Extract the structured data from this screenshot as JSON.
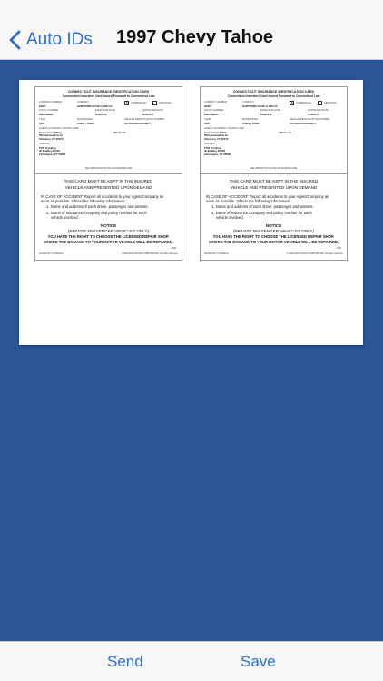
{
  "nav": {
    "back_label": "Auto IDs",
    "title": "1997 Chevy Tahoe"
  },
  "card": {
    "header1": "CONNECTICUT INSURANCE IDENTIFICATION CARD",
    "header2": "Connecticut Insurance Card Issued Pursuant to Connecticut Law",
    "company_number_label": "COMPANY NUMBER",
    "company_number": "22357",
    "company_label": "COMPANY",
    "company": "HARTFORD ACCID & IND CO",
    "commercial_label": "COMMERCIAL",
    "personal_label": "PERSONAL",
    "commercial_checked": "X",
    "policy_number_label": "POLICY NUMBER",
    "policy_number": "WBAHMWA",
    "effective_date_label": "EFFECTIVE DATE",
    "effective_date": "5/20/2016",
    "expiration_date_label": "EXPIRATION DATE",
    "expiration_date": "5/20/2017",
    "year_label": "YEAR",
    "year": "1997",
    "make_model_label": "MAKE/MODEL",
    "make_model": "Chevy / Tahoe",
    "vin_label": "VEHICLE IDENTIFICATION NUMBER",
    "vin": "1GYEK63N76R168971",
    "agency_label": "AGENCY/COMPANY ISSUING CARD",
    "agency_lines": [
      "Connecticut Office",
      "559 Hopmeadow St",
      "Simsbury, CT 06070"
    ],
    "vehicle_location": "Vehicle Co",
    "insured_label": "INSURED",
    "insured_lines": [
      "FTW Trucking",
      "40 Bradley Rd Rd",
      "Farmington, CT 06085"
    ],
    "see_notice": "SEE IMPORTANT NOTICE ON REVERSE SIDE",
    "keep_line1": "THIS CARD MUST BE KEPT IN THE INSURED",
    "keep_line2": "VEHICLE AND PRESENTED UPON DEMAND",
    "accident_line1": "IN CASE OF ACCIDENT:  Report all accidents to your Agent/Company as",
    "accident_line2": "soon as possible.  Obtain the following information:",
    "item1": "1.  Name and address of each driver, passenger and witness.",
    "item2a": "2.  Name of Insurance Company and policy number for each",
    "item2b": "vehicle involved.",
    "notice_title": "NOTICE",
    "notice_sub": "(PRIVATE PASSENGER VEHICLES ONLY)",
    "repair1": "YOU HAVE THE RIGHT TO CHOOSE THE LICENSED REPAIR SHOP.",
    "repair2": "WHERE THE DAMAGE TO YOUR MOTOR VEHICLE WILL BE REPAIRED.",
    "year_code": "2006",
    "form_code": "ACORD 50 CT (2006/01)",
    "copyright": "© 2000-2006 ACORD CORPORATION. All rights reserved."
  },
  "toolbar": {
    "send_label": "Send",
    "save_label": "Save"
  },
  "colors": {
    "accent": "#2a6ed8",
    "background": "#2a5698"
  },
  "icons": {
    "back": "chevron-left-icon"
  }
}
